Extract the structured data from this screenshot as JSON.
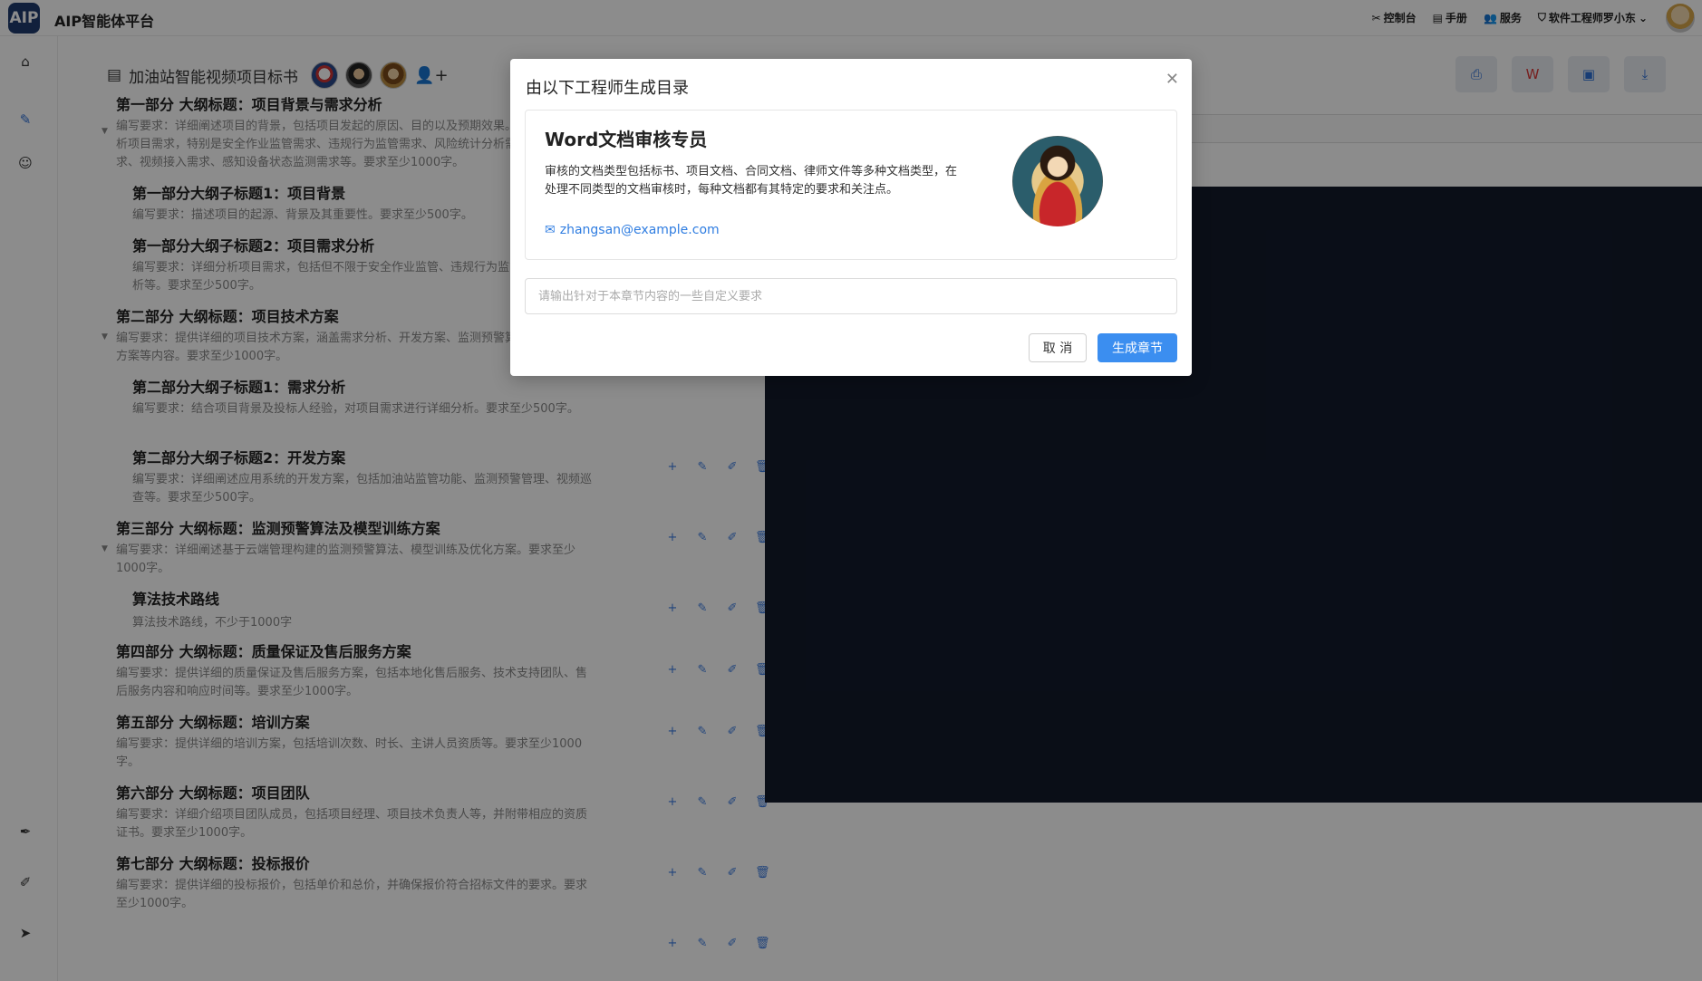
{
  "app": {
    "logo": "AIP",
    "title": "AIP智能体平台"
  },
  "topnav": [
    {
      "icon": "tools-icon",
      "glyph": "✂",
      "label": "控制台"
    },
    {
      "icon": "manual-icon",
      "glyph": "▤",
      "label": "手册"
    },
    {
      "icon": "service-icon",
      "glyph": "👥",
      "label": "服务"
    },
    {
      "icon": "shield-icon",
      "glyph": "⛉",
      "label": "软件工程师罗小东"
    }
  ],
  "doc": {
    "title": "加油站智能视频项目标书"
  },
  "outline": [
    {
      "title": "第一部分 大纲标题：项目背景与需求分析",
      "req": "编写要求：详细阐述项目的背景，包括项目发起的原因、目的以及预期效果。同时，深入分析项目需求，特别是安全作业监管需求、违规行为监管需求、风险统计分析需求、对象需求、视频接入需求、感知设备状态监测需求等。要求至少1000字。"
    },
    {
      "title": "第一部分大纲子标题1：项目背景",
      "req": "编写要求：描述项目的起源、背景及其重要性。要求至少500字。"
    },
    {
      "title": "第一部分大纲子标题2：项目需求分析",
      "req": "编写要求：详细分析项目需求，包括但不限于安全作业监管、违规行为监管、风险统计分析等。要求至少500字。"
    },
    {
      "title": "第二部分 大纲标题：项目技术方案",
      "req": "编写要求：提供详细的项目技术方案，涵盖需求分析、开发方案、监测预警算法及模型训练方案等内容。要求至少1000字。"
    },
    {
      "title": "第二部分大纲子标题1：需求分析",
      "req": "编写要求：结合项目背景及投标人经验，对项目需求进行详细分析。要求至少500字。"
    },
    {
      "title": "第二部分大纲子标题2：开发方案",
      "req": "编写要求：详细阐述应用系统的开发方案，包括加油站监管功能、监测预警管理、视频巡查等。要求至少500字。"
    },
    {
      "title": "第三部分 大纲标题：监测预警算法及模型训练方案",
      "req": "编写要求：详细阐述基于云端管理构建的监测预警算法、模型训练及优化方案。要求至少1000字。"
    },
    {
      "title": "算法技术路线",
      "req": "算法技术路线，不少于1000字"
    },
    {
      "title": "第四部分 大纲标题：质量保证及售后服务方案",
      "req": "编写要求：提供详细的质量保证及售后服务方案，包括本地化售后服务、技术支持团队、售后服务内容和响应时间等。要求至少1000字。"
    },
    {
      "title": "第五部分 大纲标题：培训方案",
      "req": "编写要求：提供详细的培训方案，包括培训次数、时长、主讲人员资质等。要求至少1000字。"
    },
    {
      "title": "第六部分 大纲标题：项目团队",
      "req": "编写要求：详细介绍项目团队成员，包括项目经理、项目技术负责人等，并附带相应的资质证书。要求至少1000字。"
    },
    {
      "title": "第七部分 大纲标题：投标报价",
      "req": "编写要求：提供详细的投标报价，包括单价和总价，并确保报价符合招标文件的要求。要求至少1000字。"
    }
  ],
  "modal": {
    "title": "由以下工程师生成目录",
    "engineer_name": "Word文档审核专员",
    "engineer_desc": "审核的文档类型包括标书、项目文档、合同文档、律师文件等多种文档类型，在处理不同类型的文档审核时，每种文档都有其特定的要求和关注点。",
    "engineer_email": "zhangsan@example.com",
    "input_placeholder": "请输出针对于本章节内容的一些自定义要求",
    "cancel_label": "取 消",
    "confirm_label": "生成章节"
  }
}
